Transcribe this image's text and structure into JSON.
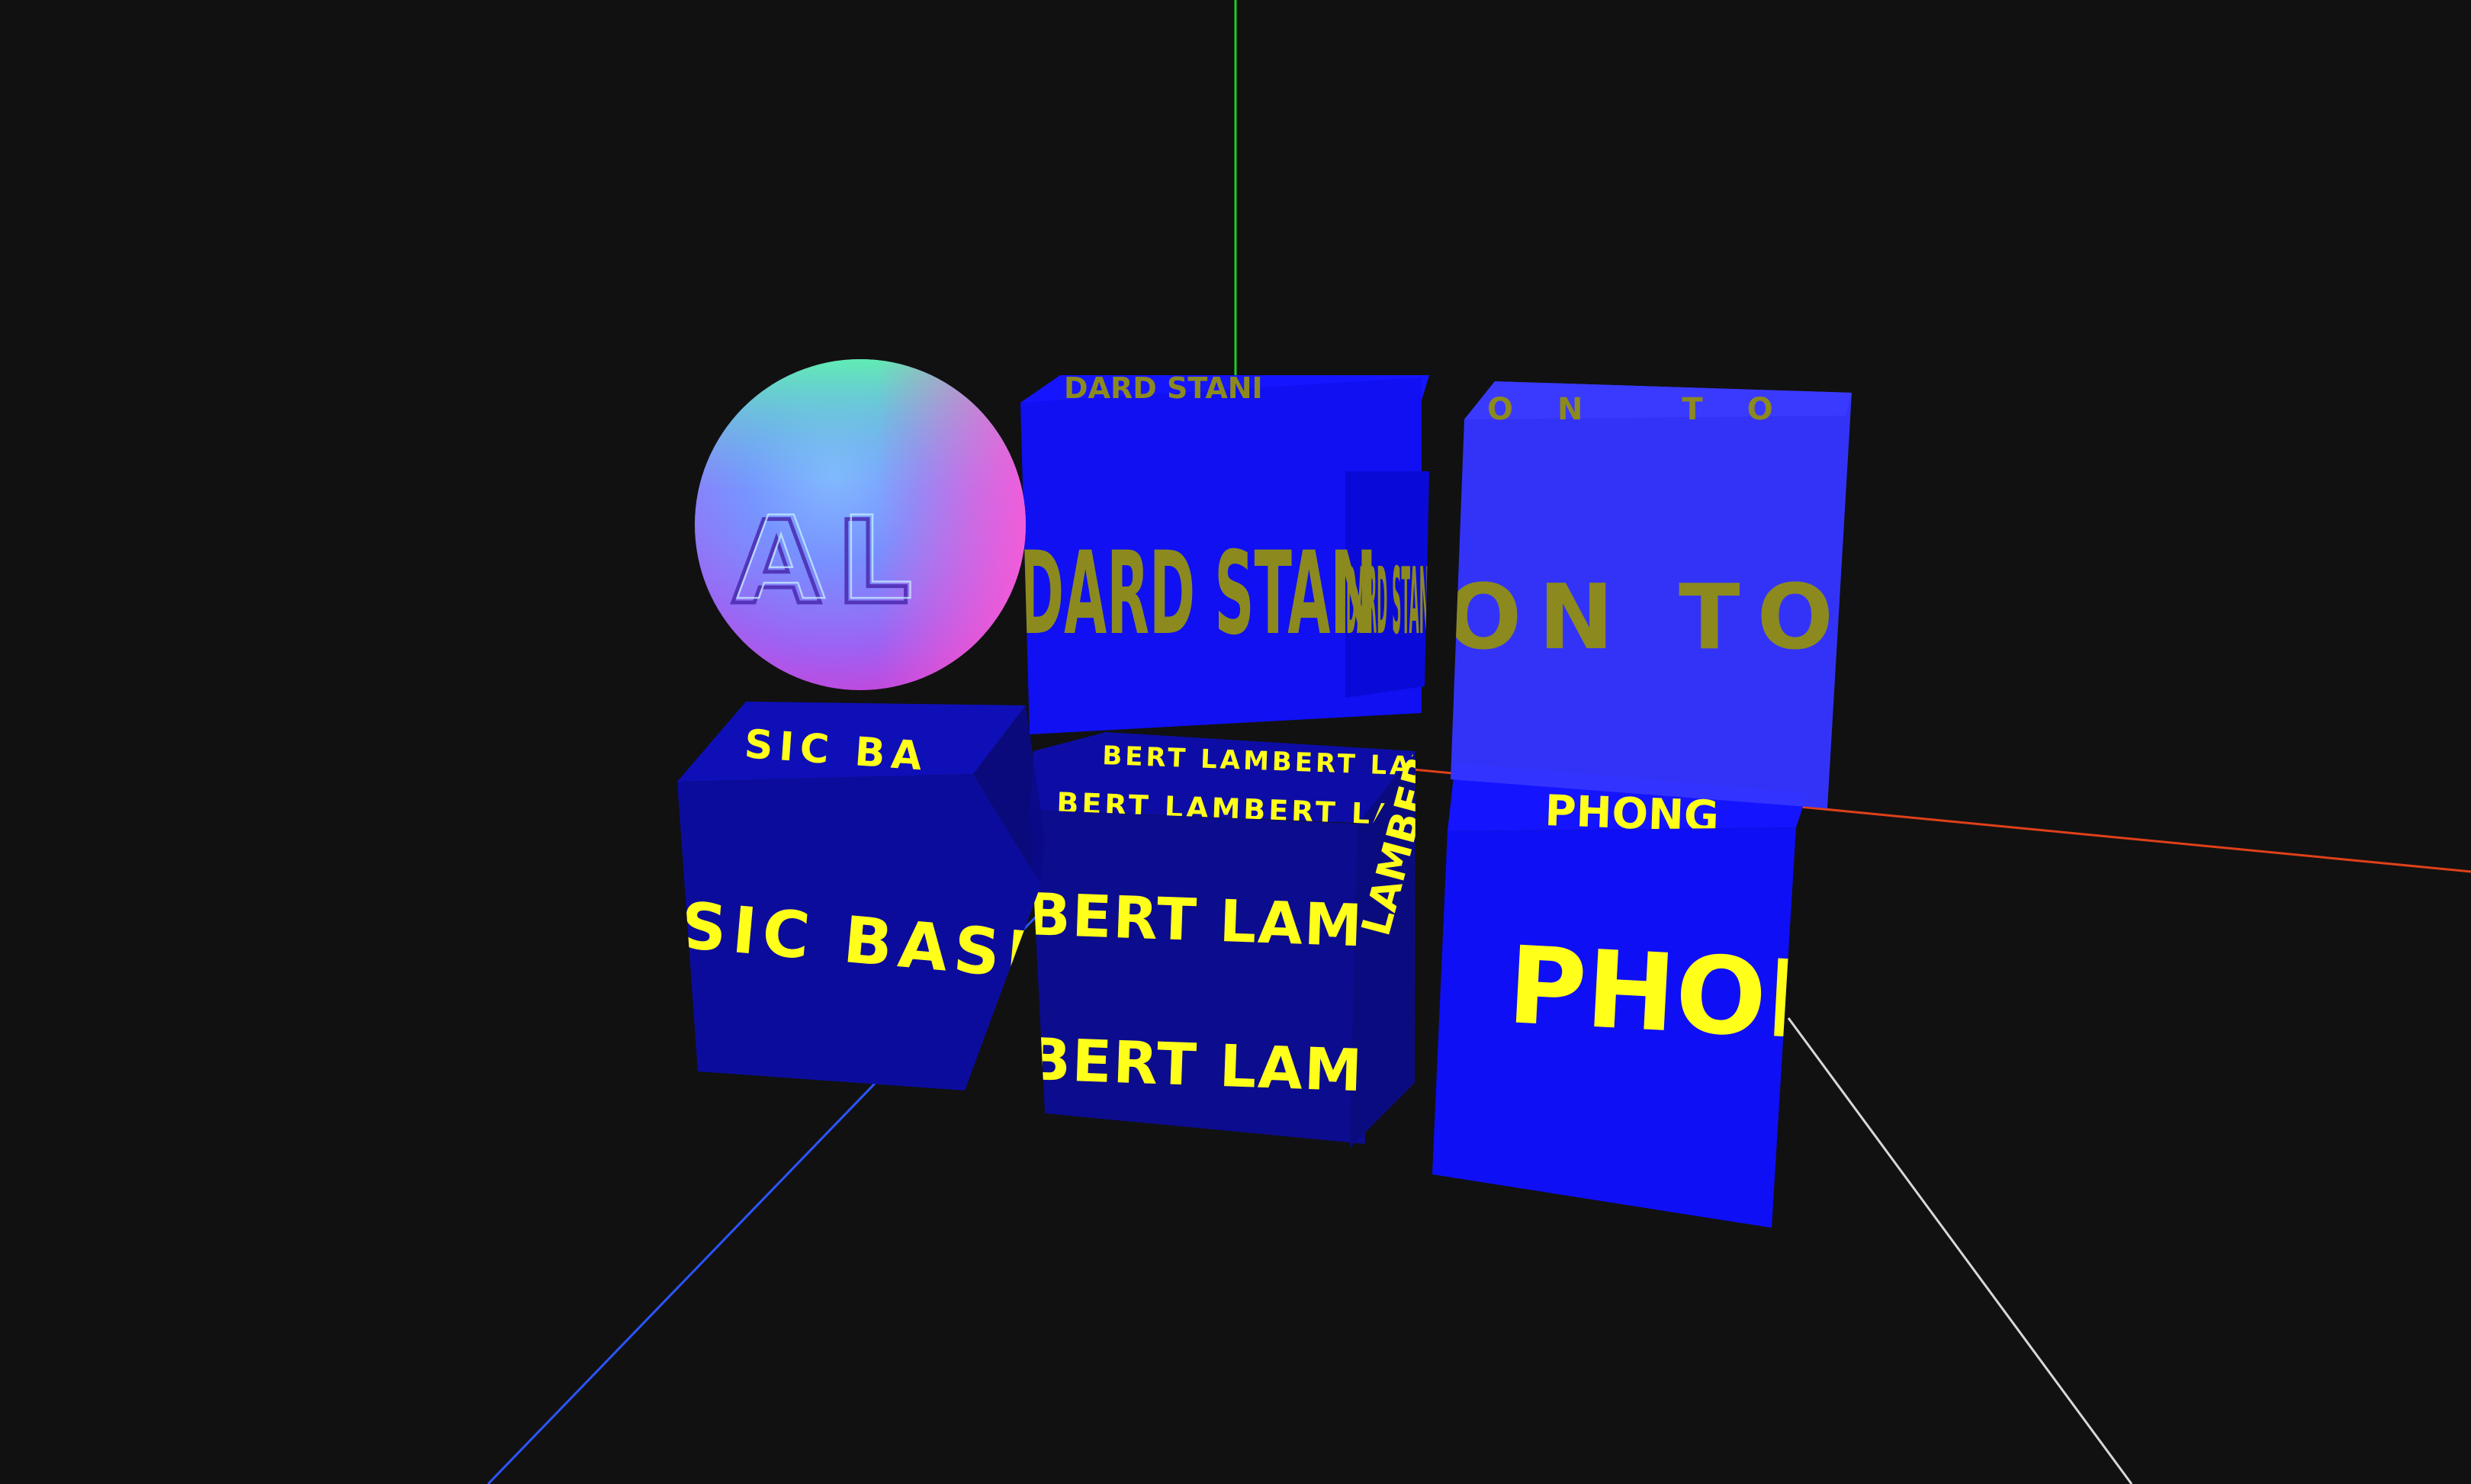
{
  "scene": {
    "background": "#111111",
    "axes": {
      "x_color": "#e0401a",
      "y_color": "#22cc22",
      "z_color": "#2b55ff",
      "extra_line_color": "#d8d8d8"
    },
    "sphere": {
      "material_label": "NORMAL",
      "visible_text": "AL"
    },
    "cubes": {
      "standard": {
        "label_top": "DARD STANI",
        "label_front": "DARD STAN",
        "label_side": "DARD STAN",
        "face_front": "#1010f2",
        "face_side": "#0a0ad8",
        "text_color": "#8c8a1e"
      },
      "toon": {
        "label_top": "ON TO",
        "label_front": "ON TO",
        "face_front": "#3535ff",
        "text_color": "#8c8a1e"
      },
      "basic": {
        "label_top": "SIC BA",
        "label_front": "SIC BASIC",
        "face_front": "#0c0c9c",
        "face_top": "#0f0fb8",
        "text_color": "#ffff1a"
      },
      "lambert": {
        "label_top_row1": "BERT LAMBERT LAMI",
        "label_top_row2": "BERT LAMBERT LAMI",
        "label_front_row1": "BERT LAMBERT LAMBE",
        "label_front_row2": "BERT LAMBERT LAMBE",
        "label_side": "LAMBERT",
        "face_front": "#0c0c8e",
        "face_top": "#0d0da6",
        "text_color": "#ffff1a"
      },
      "phong": {
        "label_top": "PHONG",
        "label_front": "PHONG",
        "face_front": "#0f0ff5",
        "face_top": "#1414ff",
        "text_color": "#ffff1a"
      }
    }
  }
}
